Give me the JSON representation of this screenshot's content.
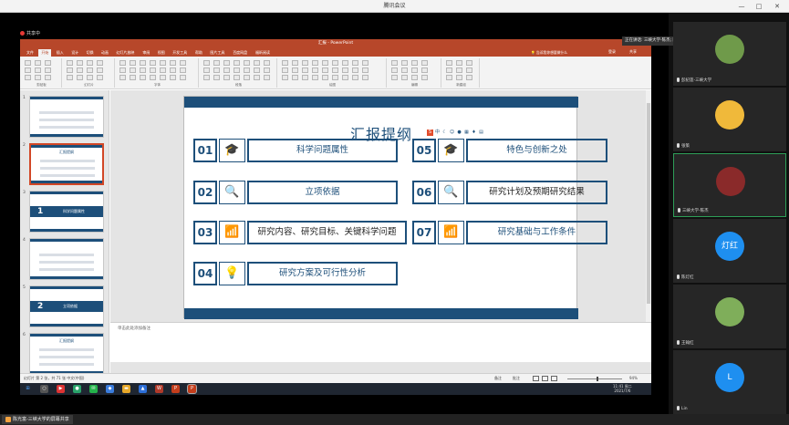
{
  "meeting": {
    "title": "腾讯会议",
    "sharing_badge": "共享中",
    "speaker_label": "正在讲话: 三峡大学-陈杰; 陈光...",
    "bottom_label": "陈光富-三峡大学的屏幕共享",
    "minimize": "—",
    "maximize": "□",
    "close": "✕"
  },
  "ppt": {
    "title": "汇报 - PowerPoint",
    "tabs": [
      "文件",
      "开始",
      "插入",
      "设计",
      "切换",
      "动画",
      "幻灯片放映",
      "审阅",
      "视图",
      "开发工具",
      "帮助",
      "图片工具",
      "百度网盘",
      "福昕阅读"
    ],
    "tell_me": "告诉我你想要做什么",
    "login": "登录",
    "share": "共享",
    "ribbon_groups": [
      "剪贴板",
      "幻灯片",
      "字体",
      "段落",
      "绘图",
      "编辑",
      "新建组"
    ],
    "notes_placeholder": "单击此处添加备注",
    "status_left": "幻灯片 第 2 张，共 71 张    中文(中国)",
    "notes_btn": "备注",
    "comments_btn": "批注",
    "zoom": "94%",
    "thumb_numbers": [
      "1",
      "2",
      "3",
      "4",
      "5",
      "6"
    ],
    "thumb_texts": [
      "",
      "汇报提纲",
      "科学问题属性",
      "",
      "立项依据",
      "汇报提纲"
    ],
    "thumb_section_nums": [
      "",
      "",
      "1",
      "",
      "2",
      ""
    ]
  },
  "slide": {
    "title": "汇报提纲",
    "items": [
      {
        "num": "01",
        "label": "科学问题属性",
        "icon": "graduation-cap-icon",
        "glyph": "🎓"
      },
      {
        "num": "02",
        "label": "立项依据",
        "icon": "document-search-icon",
        "glyph": "🔍"
      },
      {
        "num": "03",
        "label": "研究内容、研究目标、关键科学问题",
        "icon": "bar-chart-icon",
        "glyph": "📶"
      },
      {
        "num": "04",
        "label": "研究方案及可行性分析",
        "icon": "lightbulb-icon",
        "glyph": "💡"
      },
      {
        "num": "05",
        "label": "特色与创新之处",
        "icon": "graduation-cap-icon",
        "glyph": "🎓"
      },
      {
        "num": "06",
        "label": "研究计划及预期研究结果",
        "icon": "document-search-icon",
        "glyph": "🔍"
      },
      {
        "num": "07",
        "label": "研究基础与工作条件",
        "icon": "bar-chart-icon",
        "glyph": "📶"
      }
    ]
  },
  "taskbar": {
    "time": "11:41 周二",
    "date": "2021/7/6"
  },
  "participants": [
    {
      "name": "彭纪莲-三峡大学",
      "avatar_text": "",
      "active": false
    },
    {
      "name": "张策",
      "avatar_text": "",
      "active": false
    },
    {
      "name": "三峡大学-陈杰",
      "avatar_text": "",
      "active": true
    },
    {
      "name": "陈灯红",
      "avatar_text": "灯红",
      "active": false
    },
    {
      "name": "王翰红",
      "avatar_text": "",
      "active": false
    },
    {
      "name": "Lin",
      "avatar_text": "L",
      "active": false
    }
  ],
  "colors": {
    "ppt_red": "#b7472a",
    "slide_blue": "#1d4f7a",
    "active_green": "#2e9e57",
    "avatar_blue": "#1e8ff0"
  }
}
